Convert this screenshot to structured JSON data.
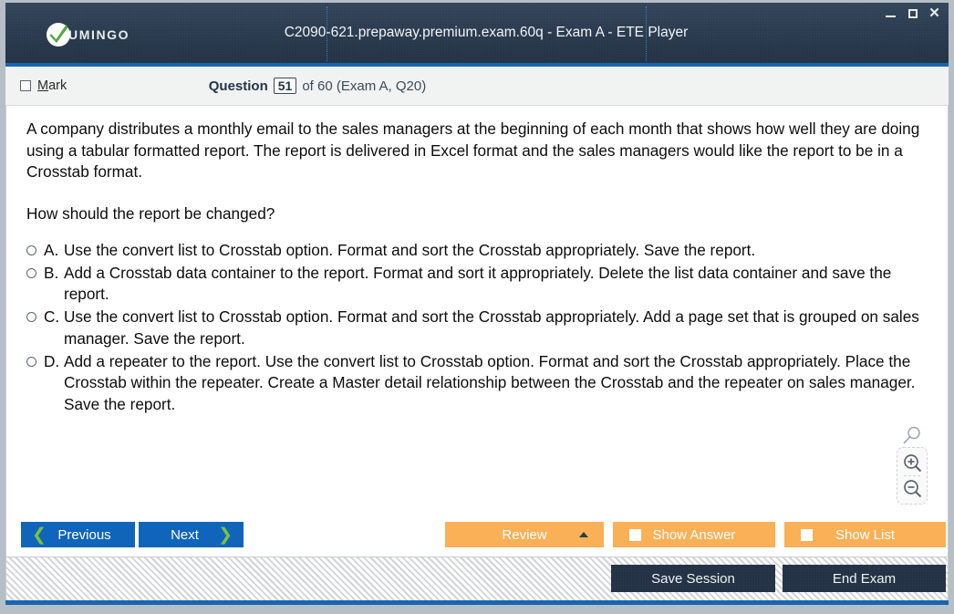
{
  "window": {
    "title": "C2090-621.prepaway.premium.exam.60q - Exam A - ETE Player",
    "logo_text": "UMINGO",
    "minimize_label": "Minimize",
    "maximize_label": "Maximize",
    "close_label": "✕"
  },
  "question_header": {
    "mark_label_prefix": "M",
    "mark_label_rest": "ark",
    "question_word": "Question",
    "question_number": "51",
    "question_rest": "of 60 (Exam A, Q20)"
  },
  "content": {
    "question_text": "A company distributes a monthly email to the sales managers at the beginning of each month that shows how well they are doing using a tabular formatted report. The report is delivered in Excel format and the sales managers would like the report to be in a Crosstab format.",
    "prompt": "How should the report be changed?",
    "options": [
      {
        "letter": "A.",
        "text": "Use the convert list to Crosstab option. Format and sort the Crosstab appropriately. Save the report."
      },
      {
        "letter": "B.",
        "text": "Add a Crosstab data container to the report. Format and sort it appropriately. Delete the list data container and save the report."
      },
      {
        "letter": "C.",
        "text": "Use the convert list to Crosstab option. Format and sort the Crosstab appropriately. Add a page set that is grouped on sales manager. Save the report."
      },
      {
        "letter": "D.",
        "text": "Add a repeater to the report. Use the convert list to Crosstab option. Format and sort the Crosstab appropriately. Place the Crosstab within the repeater. Create a Master detail relationship between the Crosstab and the repeater on sales manager. Save the report."
      }
    ]
  },
  "zoom_widget": {
    "magnifier_icon": "magnifier-icon",
    "zoom_in_icon": "zoom-in-icon",
    "zoom_out_icon": "zoom-out-icon"
  },
  "buttons": {
    "previous": "Previous",
    "next": "Next",
    "review": "Review",
    "show_answer": "Show Answer",
    "show_list": "Show List",
    "save_session": "Save Session",
    "end_exam": "End Exam"
  },
  "colors": {
    "titlebar": "#2b3c50",
    "accent_blue": "#1766b0",
    "nav_button": "#1065bb",
    "chevron_green": "#7ac143",
    "orange_button": "#f9b057",
    "dark_button": "#243246",
    "frame": "#b6bfc6"
  }
}
